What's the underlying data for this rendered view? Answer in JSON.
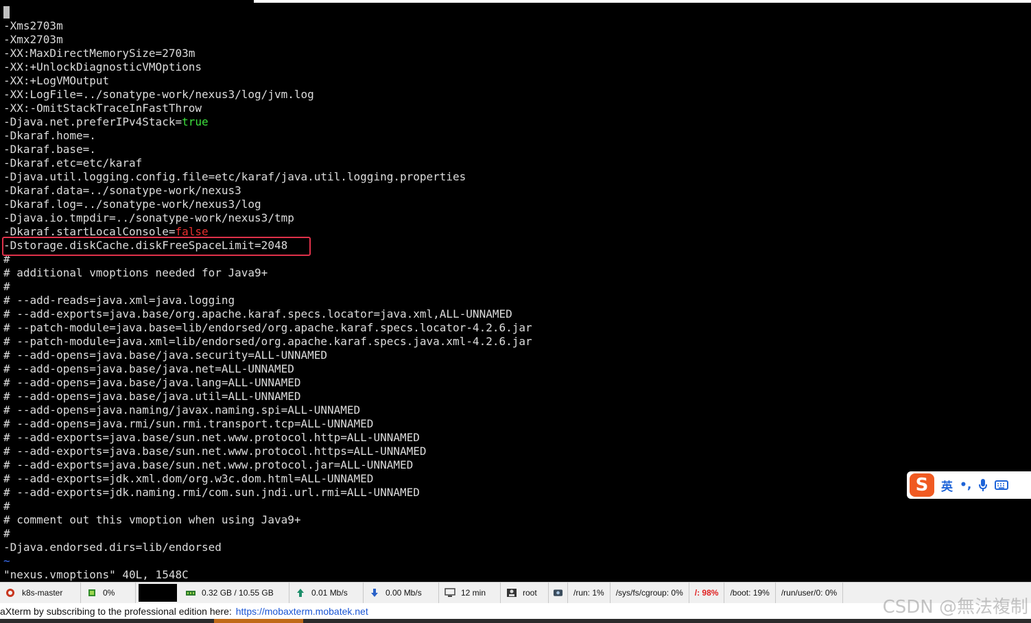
{
  "terminal": {
    "lines": [
      {
        "text": "-Xms2703m"
      },
      {
        "text": "-Xmx2703m"
      },
      {
        "text": "-XX:MaxDirectMemorySize=2703m"
      },
      {
        "text": "-XX:+UnlockDiagnosticVMOptions"
      },
      {
        "text": "-XX:+LogVMOutput"
      },
      {
        "text": "-XX:LogFile=../sonatype-work/nexus3/log/jvm.log"
      },
      {
        "text": "-XX:-OmitStackTraceInFastThrow"
      },
      {
        "text": "-Djava.net.preferIPv4Stack=",
        "value": "true",
        "value_style": "green"
      },
      {
        "text": "-Dkaraf.home=."
      },
      {
        "text": "-Dkaraf.base=."
      },
      {
        "text": "-Dkaraf.etc=etc/karaf"
      },
      {
        "text": "-Djava.util.logging.config.file=etc/karaf/java.util.logging.properties"
      },
      {
        "text": "-Dkaraf.data=../sonatype-work/nexus3"
      },
      {
        "text": "-Dkaraf.log=../sonatype-work/nexus3/log"
      },
      {
        "text": "-Djava.io.tmpdir=../sonatype-work/nexus3/tmp"
      },
      {
        "text": "-Dkaraf.startLocalConsole=",
        "value": "false",
        "value_style": "red"
      },
      {
        "text": "-Dstorage.diskCache.diskFreeSpaceLimit=2048",
        "highlighted": true
      },
      {
        "text": "#"
      },
      {
        "text": "# additional vmoptions needed for Java9+"
      },
      {
        "text": "#"
      },
      {
        "text": "# --add-reads=java.xml=java.logging"
      },
      {
        "text": "# --add-exports=java.base/org.apache.karaf.specs.locator=java.xml,ALL-UNNAMED"
      },
      {
        "text": "# --patch-module=java.base=lib/endorsed/org.apache.karaf.specs.locator-4.2.6.jar"
      },
      {
        "text": "# --patch-module=java.xml=lib/endorsed/org.apache.karaf.specs.java.xml-4.2.6.jar"
      },
      {
        "text": "# --add-opens=java.base/java.security=ALL-UNNAMED"
      },
      {
        "text": "# --add-opens=java.base/java.net=ALL-UNNAMED"
      },
      {
        "text": "# --add-opens=java.base/java.lang=ALL-UNNAMED"
      },
      {
        "text": "# --add-opens=java.base/java.util=ALL-UNNAMED"
      },
      {
        "text": "# --add-opens=java.naming/javax.naming.spi=ALL-UNNAMED"
      },
      {
        "text": "# --add-opens=java.rmi/sun.rmi.transport.tcp=ALL-UNNAMED"
      },
      {
        "text": "# --add-exports=java.base/sun.net.www.protocol.http=ALL-UNNAMED"
      },
      {
        "text": "# --add-exports=java.base/sun.net.www.protocol.https=ALL-UNNAMED"
      },
      {
        "text": "# --add-exports=java.base/sun.net.www.protocol.jar=ALL-UNNAMED"
      },
      {
        "text": "# --add-exports=jdk.xml.dom/org.w3c.dom.html=ALL-UNNAMED"
      },
      {
        "text": "# --add-exports=jdk.naming.rmi/com.sun.jndi.url.rmi=ALL-UNNAMED"
      },
      {
        "text": "#"
      },
      {
        "text": "# comment out this vmoption when using Java9+"
      },
      {
        "text": "#"
      },
      {
        "text": "-Djava.endorsed.dirs=lib/endorsed"
      },
      {
        "text": "~",
        "value_style": "tilde"
      },
      {
        "text": "\"nexus.vmoptions\" 40L, 1548C"
      }
    ]
  },
  "ime": {
    "logo_char": "S",
    "lang": "英",
    "punct": "•,",
    "mic_icon": "microphone-icon",
    "keyboard_icon": "keyboard-icon"
  },
  "statusbar": {
    "host": "k8s-master",
    "cpu": "0%",
    "memory": "0.32 GB / 10.55 GB",
    "upload": "0.01 Mb/s",
    "download": "0.00 Mb/s",
    "uptime": "12 min",
    "user": "root",
    "disks": [
      {
        "label": "/run: 1%"
      },
      {
        "label": "/sys/fs/cgroup: 0%"
      },
      {
        "label": "/: 98%",
        "alert": true
      },
      {
        "label": "/boot: 19%"
      },
      {
        "label": "/run/user/0: 0%"
      }
    ],
    "colors": {
      "alert": "#e02020"
    }
  },
  "promo": {
    "text": "aXterm by subscribing to the professional edition here:",
    "link": "https://mobaxterm.mobatek.net"
  },
  "watermark": "CSDN @無法複制"
}
